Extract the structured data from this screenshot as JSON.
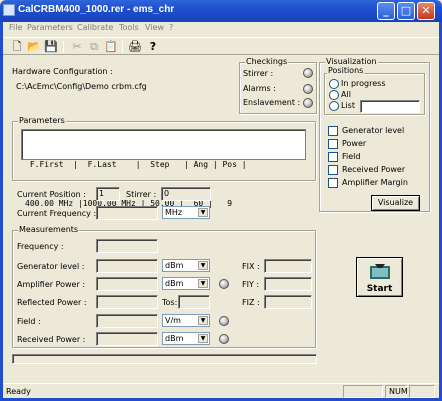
{
  "window": {
    "title": "CalCRBM400_1000.rer - ems_chr"
  },
  "menu": [
    "File",
    "Parameters",
    "Calibrate",
    "Tools",
    "View",
    "?"
  ],
  "toolbar": {
    "new": "🗋",
    "open": "📂",
    "save": "💾",
    "cut": "✂",
    "copy": "⧉",
    "paste": "📋",
    "print": "🖨",
    "help": "?"
  },
  "hardware": {
    "label": "Hardware Configuration :",
    "path": "C:\\AcEmc\\Config\\Demo crbm.cfg"
  },
  "checkings": {
    "title": "Checkings",
    "stirrer": "Stirrer :",
    "alarms": "Alarms :",
    "enslavement": "Enslavement :"
  },
  "visualization": {
    "title": "Visualization",
    "positions_title": "Positions",
    "radio_in_progress": "In progress",
    "radio_all": "All",
    "radio_list": "List",
    "list_value": "",
    "chk_generator": "Generator level",
    "chk_power": "Power",
    "chk_field": "Field",
    "chk_received": "Received Power",
    "chk_amplifier": "Amplifier Margin",
    "button": "Visualize"
  },
  "parameters": {
    "title": "Parameters",
    "header": " F.First  |  F.Last    |  Step   | Ang | Pos |",
    "row": "400.00 MHz |1000.00 MHz | 50.00 |  60 |   9"
  },
  "position": {
    "current_position_label": "Current Position :",
    "current_position_value": "1",
    "stirrer_label": "Stirrer :",
    "stirrer_value": "0",
    "current_frequency_label": "Current Frequency :",
    "current_frequency_value": "",
    "frequency_unit": "MHz"
  },
  "measurements": {
    "title": "Measurements",
    "frequency_label": "Frequency :",
    "generator_label": "Generator level :",
    "generator_unit": "dBm",
    "amplifier_label": "Amplifier Power :",
    "amplifier_unit": "dBm",
    "reflected_label": "Reflected Power :",
    "tos_label": "Tos:",
    "field_label": "Field :",
    "field_unit": "V/m",
    "received_label": "Received  Power :",
    "received_unit": "dBm",
    "fix_label": "FIX :",
    "fiy_label": "FIY :",
    "fiz_label": "FIZ :"
  },
  "start_button": "Start",
  "status": {
    "text": "Ready",
    "num": "NUM"
  }
}
